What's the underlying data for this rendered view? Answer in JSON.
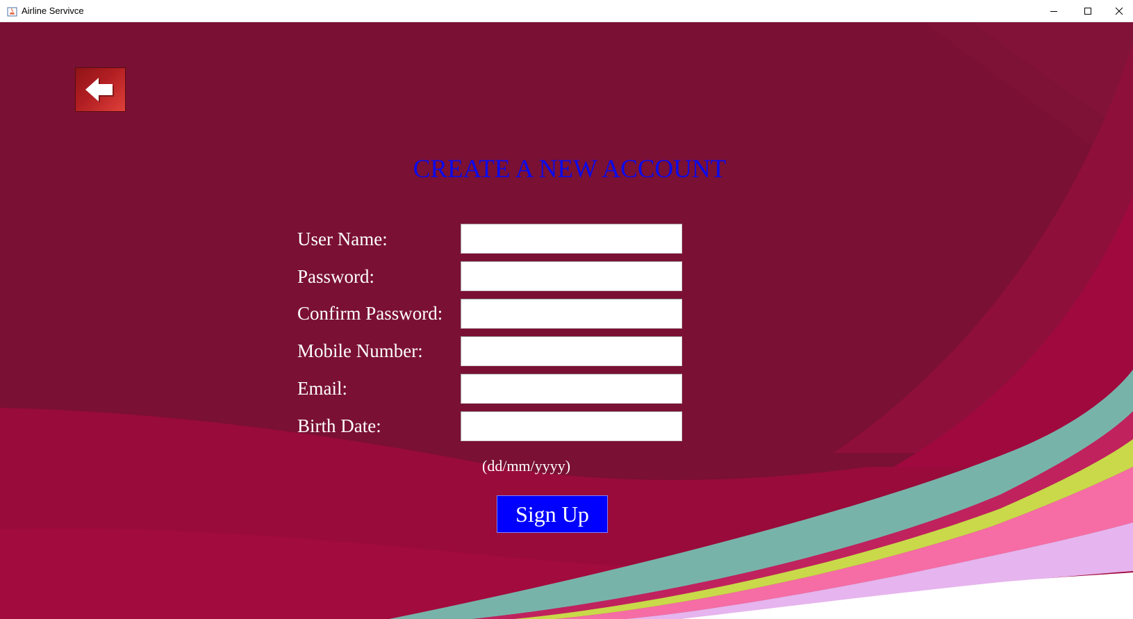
{
  "window": {
    "title": "Airline Servivce"
  },
  "page": {
    "title": "CREATE A NEW ACCOUNT"
  },
  "form": {
    "fields": [
      {
        "label": "User Name:",
        "value": "",
        "type": "text"
      },
      {
        "label": "Password:",
        "value": "",
        "type": "password"
      },
      {
        "label": "Confirm Password:",
        "value": "",
        "type": "password"
      },
      {
        "label": "Mobile Number:",
        "value": "",
        "type": "text"
      },
      {
        "label": "Email:",
        "value": "",
        "type": "text"
      },
      {
        "label": "Birth Date:",
        "value": "",
        "type": "text"
      }
    ],
    "date_hint": "(dd/mm/yyyy)",
    "submit_label": "Sign Up"
  },
  "icons": {
    "back": "arrow-left-icon",
    "app": "java-app-icon",
    "minimize": "minimize-icon",
    "maximize": "maximize-icon",
    "close": "close-icon"
  },
  "colors": {
    "background": "#7a1034",
    "title": "#0a0aee",
    "button": "#0000ff",
    "back_button": "#b11e22"
  }
}
